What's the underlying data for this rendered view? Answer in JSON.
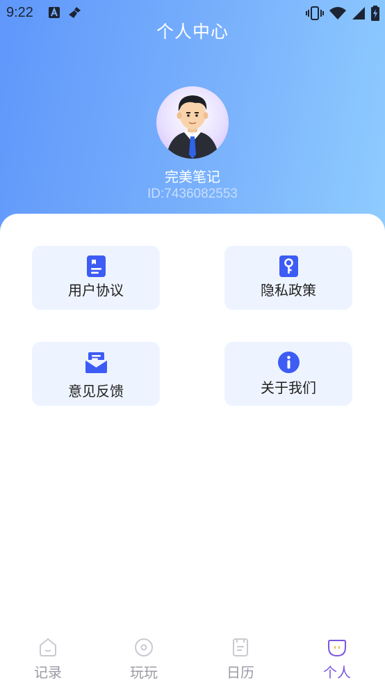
{
  "status_bar": {
    "time": "9:22",
    "left_icons": [
      "a-letter-icon",
      "brush-icon"
    ],
    "right_icons": [
      "vibrate-icon",
      "wifi-icon",
      "signal-icon",
      "battery-charging-icon"
    ]
  },
  "header": {
    "title": "个人中心"
  },
  "profile": {
    "avatar_icon": "businessman-avatar",
    "name": "完美笔记",
    "id_text": "ID:7436082553"
  },
  "menu": {
    "items": [
      {
        "label": "用户协议",
        "icon": "document-icon"
      },
      {
        "label": "隐私政策",
        "icon": "key-icon"
      },
      {
        "label": "意见反馈",
        "icon": "mail-icon"
      },
      {
        "label": "关于我们",
        "icon": "info-icon"
      }
    ]
  },
  "tabbar": {
    "items": [
      {
        "label": "记录",
        "icon": "home-icon",
        "active": false
      },
      {
        "label": "玩玩",
        "icon": "disc-icon",
        "active": false
      },
      {
        "label": "日历",
        "icon": "notebook-icon",
        "active": false
      },
      {
        "label": "个人",
        "icon": "chat-face-icon",
        "active": true
      }
    ]
  },
  "colors": {
    "gradient_start": "#5f97fb",
    "gradient_end": "#8fccff",
    "card_bg": "#eef4ff",
    "icon_blue": "#3d5cf5",
    "tab_active": "#7a55e0",
    "tab_inactive": "#9a9aa6"
  }
}
